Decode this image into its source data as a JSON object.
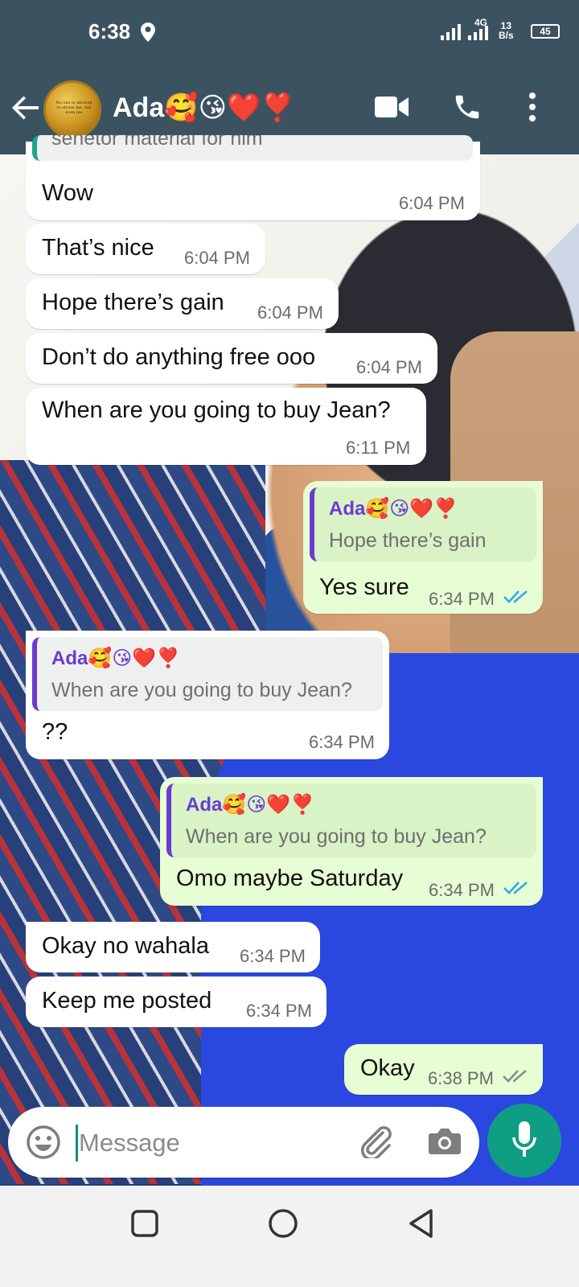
{
  "status_bar": {
    "time": "6:38",
    "network": "4G",
    "speed_top": "13",
    "speed_unit": "B/s",
    "battery": "45"
  },
  "header": {
    "contact_name": "Ada🥰😘❤️❣️",
    "avatar_text": "No one is allowed to stress me, not even me"
  },
  "messages": [
    {
      "dir": "in",
      "quote_text": "senetor material for him",
      "text": "Wow",
      "time": "6:04 PM"
    },
    {
      "dir": "in",
      "text": "That’s nice",
      "time": "6:04 PM"
    },
    {
      "dir": "in",
      "text": "Hope there’s gain",
      "time": "6:04 PM"
    },
    {
      "dir": "in",
      "text": "Don’t do anything free ooo",
      "time": "6:04 PM"
    },
    {
      "dir": "in",
      "text": "When are you going to buy Jean?",
      "time": "6:11 PM"
    },
    {
      "dir": "out",
      "quote_name": "Ada🥰😘❤️❣️",
      "quote_text": "Hope there’s gain",
      "text": "Yes sure",
      "time": "6:34 PM",
      "status": "read"
    },
    {
      "dir": "in",
      "quote_name": "Ada🥰😘❤️❣️",
      "quote_text": "When are you going to buy Jean?",
      "text": "??",
      "time": "6:34 PM"
    },
    {
      "dir": "out",
      "quote_name": "Ada🥰😘❤️❣️",
      "quote_text": "When are you going to buy Jean?",
      "text": "Omo maybe Saturday",
      "time": "6:34 PM",
      "status": "read"
    },
    {
      "dir": "in",
      "text": "Okay no wahala",
      "time": "6:34 PM"
    },
    {
      "dir": "in",
      "text": "Keep me posted",
      "time": "6:34 PM"
    },
    {
      "dir": "out",
      "text": "Okay",
      "time": "6:38 PM",
      "status": "delivered"
    }
  ],
  "composer": {
    "placeholder": "Message"
  },
  "colors": {
    "header": "#3b5361",
    "accent": "#0f9d84",
    "read_tick": "#34a8e8",
    "delivered_tick": "#8c8c8c",
    "outgoing_bubble": "#e7fdd3"
  },
  "icons": [
    "back-arrow-icon",
    "video-call-icon",
    "voice-call-icon",
    "more-options-icon",
    "emoji-icon",
    "attach-icon",
    "camera-icon",
    "mic-icon"
  ]
}
